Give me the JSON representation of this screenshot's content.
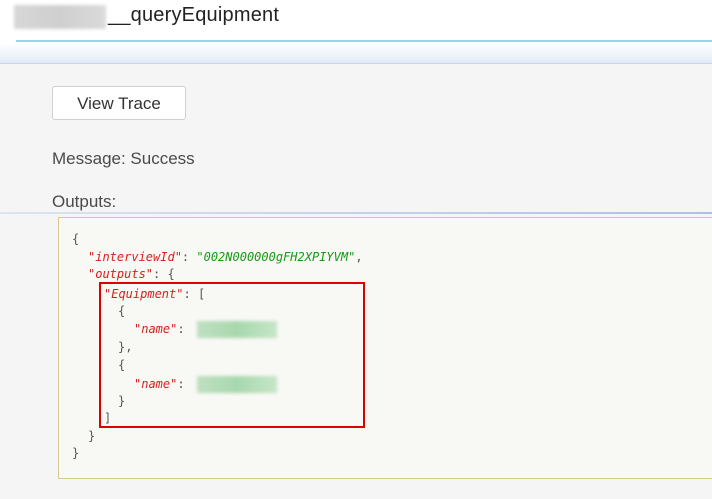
{
  "header": {
    "title_suffix": "__queryEquipment"
  },
  "actions": {
    "view_trace_label": "View Trace"
  },
  "result": {
    "message": "Message: Success",
    "outputs_label": "Outputs:"
  },
  "json_view": {
    "open_brace": "{",
    "close_brace": "}",
    "interview_key": "\"interviewId\"",
    "interview_value": "\"002N000000gFH2XPIYVM\"",
    "outputs_key": "\"outputs\"",
    "equipment_key": "\"Equipment\"",
    "name_key": "\"name\"",
    "item_open": "{",
    "item_close_comma": "},",
    "item_close": "}",
    "array_open": "[",
    "array_close": "]",
    "colon": ": ",
    "comma": ","
  },
  "colors": {
    "key": "#d62020",
    "string": "#169916",
    "highlight_border": "#e00000",
    "header_accent": "#8fd9e8"
  }
}
